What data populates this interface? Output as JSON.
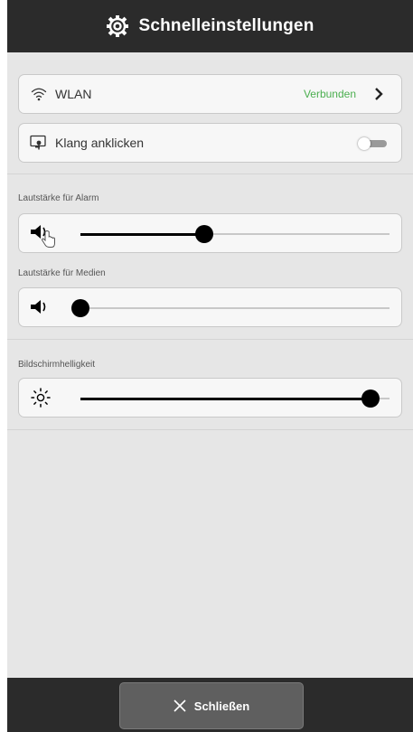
{
  "header": {
    "title": "Schnelleinstellungen",
    "icon": "gear-icon"
  },
  "wlan": {
    "label": "WLAN",
    "status": "Verbunden",
    "icon": "wifi-icon",
    "status_color": "#4caf50"
  },
  "click_sound": {
    "label": "Klang anklicken",
    "enabled": false,
    "icon": "touch-screen-icon"
  },
  "alarm_volume": {
    "label": "Lautstärke für Alarm",
    "value": 0.4,
    "icon": "speaker-icon"
  },
  "media_volume": {
    "label": "Lautstärke für Medien",
    "value": 0.0,
    "icon": "speaker-icon"
  },
  "brightness": {
    "label": "Bildschirmhelligkeit",
    "value": 0.94,
    "icon": "sun-icon"
  },
  "footer": {
    "close_label": "Schließen",
    "icon": "close-icon"
  }
}
